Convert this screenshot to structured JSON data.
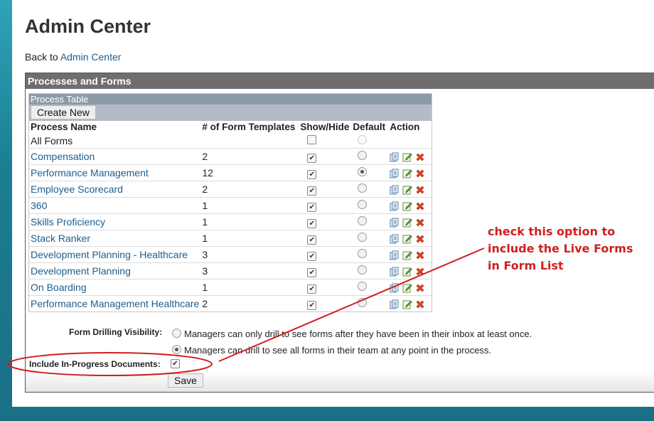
{
  "page": {
    "title": "Admin Center",
    "back_prefix": "Back to ",
    "back_link": "Admin Center"
  },
  "panel": {
    "title": "Processes and Forms",
    "table_title": "Process Table",
    "create_new_label": "Create New",
    "columns": [
      "Process Name",
      "# of Form Templates",
      "Show/Hide",
      "Default",
      "Action"
    ],
    "all_forms_label": "All Forms",
    "rows": [
      {
        "name": "Compensation",
        "count": "2",
        "shown": true,
        "default": false
      },
      {
        "name": "Performance Management",
        "count": "12",
        "shown": true,
        "default": true
      },
      {
        "name": "Employee Scorecard",
        "count": "2",
        "shown": true,
        "default": false
      },
      {
        "name": "360",
        "count": "1",
        "shown": true,
        "default": false
      },
      {
        "name": "Skills Proficiency",
        "count": "1",
        "shown": true,
        "default": false
      },
      {
        "name": "Stack Ranker",
        "count": "1",
        "shown": true,
        "default": false
      },
      {
        "name": "Development Planning - Healthcare",
        "count": "3",
        "shown": true,
        "default": false
      },
      {
        "name": "Development Planning",
        "count": "3",
        "shown": true,
        "default": false
      },
      {
        "name": "On Boarding",
        "count": "1",
        "shown": true,
        "default": false
      },
      {
        "name": "Performance Management Healthcare",
        "count": "2",
        "shown": true,
        "default": false
      }
    ],
    "action_icons": [
      "copy-icon",
      "edit-icon",
      "delete-icon"
    ]
  },
  "options": {
    "drilling_label": "Form Drilling Visibility:",
    "drilling_option_1": "Managers can only drill to see forms after they have been in their inbox at least once.",
    "drilling_option_2": "Managers can drill to see all forms in their team at any point in the process.",
    "drilling_selected": 2,
    "inprogress_label": "Include In-Progress Documents:",
    "inprogress_checked": true,
    "save_label": "Save"
  },
  "annotation": {
    "text_lines": [
      "check this option to",
      "include the Live Forms",
      "in Form List"
    ],
    "color": "#d11f1f"
  },
  "colors": {
    "panel_header": "#6e6e6e",
    "table_header": "#8d9aa8",
    "link": "#1f5d8c",
    "background_accent": "#2fa3b5"
  }
}
